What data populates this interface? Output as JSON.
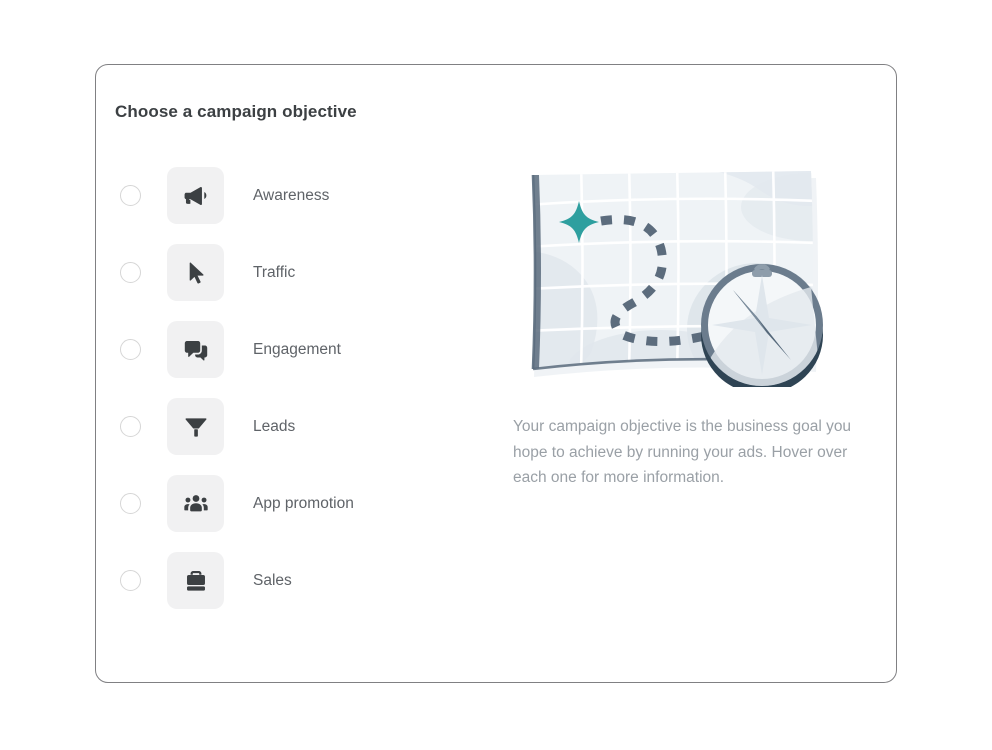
{
  "page": {
    "background_color": "#ffffff"
  },
  "card": {
    "title": "Choose a campaign objective",
    "border_color": "#808083",
    "background_color": "#ffffff"
  },
  "objectives": {
    "selected": null,
    "tile_background": "#f1f1f2",
    "icon_color": "#3c4043",
    "label_color": "#5f6368",
    "items": [
      {
        "label": "Awareness",
        "icon": "megaphone-icon",
        "selected": false
      },
      {
        "label": "Traffic",
        "icon": "cursor-arrow-icon",
        "selected": false
      },
      {
        "label": "Engagement",
        "icon": "chat-bubbles-icon",
        "selected": false
      },
      {
        "label": "Leads",
        "icon": "funnel-filter-icon",
        "selected": false
      },
      {
        "label": "App promotion",
        "icon": "people-group-icon",
        "selected": false
      },
      {
        "label": "Sales",
        "icon": "briefcase-icon",
        "selected": false
      }
    ]
  },
  "info_panel": {
    "illustration_name": "map-and-compass-illustration",
    "description": "Your campaign objective is the business goal you hope to achieve by running your ads. Hover over each one for more information.",
    "description_color": "#9aa0a6",
    "colors": {
      "map_paper": "#eff3f6",
      "map_grid": "#ffffff",
      "map_edge": "#5a6b7d",
      "dashed_path": "#5c6c7d",
      "star_teal": "#2e9f9f",
      "compass_rim": "#6b7c8d",
      "compass_face": "#eef1f4",
      "compass_shadow": "#2f4454"
    }
  }
}
